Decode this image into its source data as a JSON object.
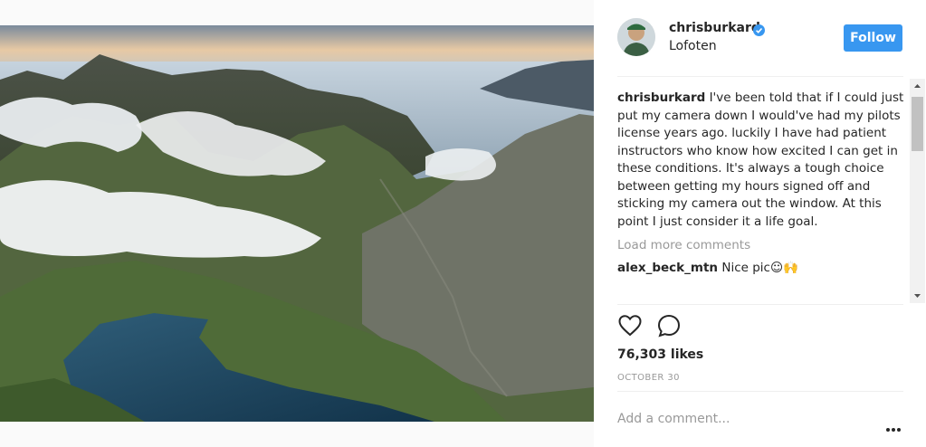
{
  "post": {
    "username": "chrisburkard",
    "location": "Lofoten",
    "follow_label": "Follow",
    "caption_user": "chrisburkard",
    "caption_text": "I've been told that if I could just put my camera down I would've had my pilots license years ago. luckily I have had patient instructors who know how excited I can get in these conditions. It's always a tough choice between getting my hours signed off and sticking my camera out the window. At this point I just consider it a life goal.",
    "load_more": "Load more comments",
    "comments": [
      {
        "user": "alex_beck_mtn",
        "text": "Nice pic☺🙌"
      }
    ],
    "likes": "76,303 likes",
    "date": "OCTOBER 30",
    "add_comment_placeholder": "Add a comment..."
  },
  "colors": {
    "accent": "#3897f0",
    "text": "#262626",
    "muted": "#999999"
  },
  "icons": [
    "verified-badge-icon",
    "heart-icon",
    "comment-icon",
    "more-options-icon",
    "scroll-up-arrow-icon",
    "scroll-down-arrow-icon"
  ]
}
